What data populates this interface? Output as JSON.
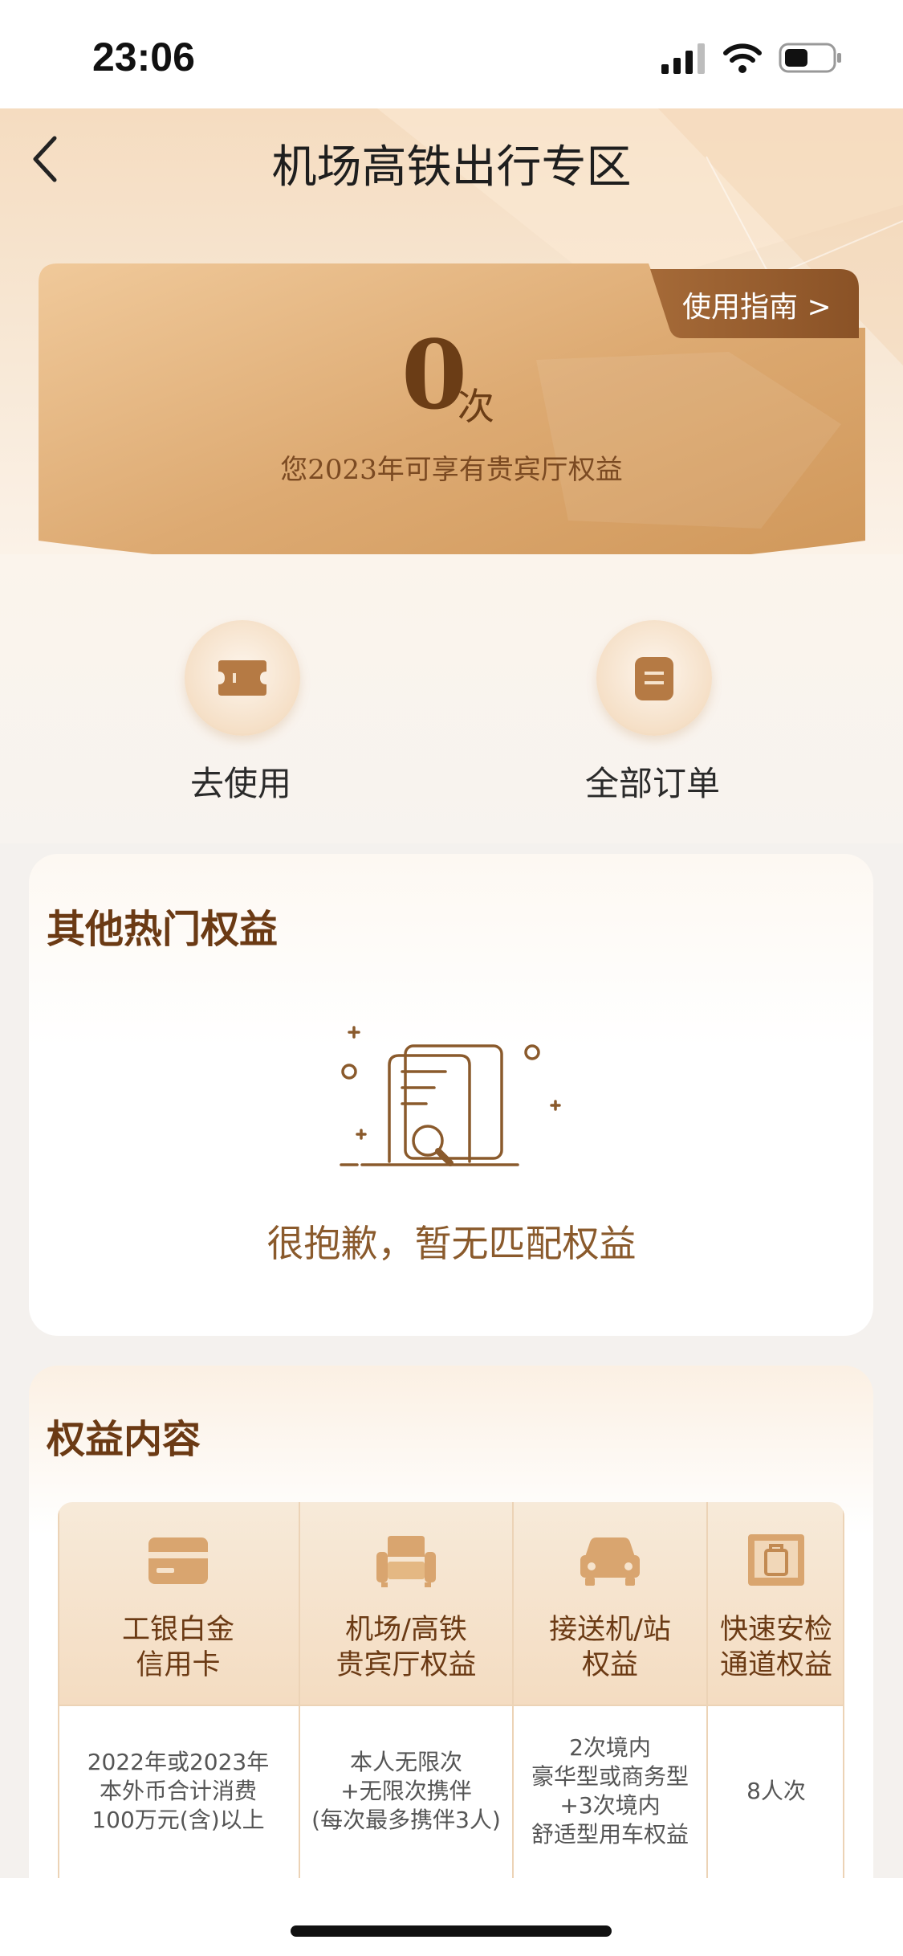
{
  "status_bar": {
    "time": "23:06"
  },
  "header": {
    "title": "机场高铁出行专区"
  },
  "summary": {
    "count": "0",
    "unit": "次",
    "description": "您2023年可享有贵宾厅权益",
    "guide_label": "使用指南 >"
  },
  "actions": [
    {
      "label": "去使用",
      "icon": "ticket-icon"
    },
    {
      "label": "全部订单",
      "icon": "order-list-icon"
    }
  ],
  "hot_rights": {
    "title": "其他热门权益",
    "empty_text": "很抱歉，暂无匹配权益",
    "empty_icon": "document-search-icon"
  },
  "rights": {
    "title": "权益内容",
    "columns": [
      {
        "icon": "credit-card-icon",
        "line1": "工银白金",
        "line2": "信用卡",
        "cell": [
          "2022年或2023年",
          "本外币合计消费",
          "100万元(含)以上"
        ]
      },
      {
        "icon": "armchair-icon",
        "line1": "机场/高铁",
        "line2": "贵宾厅权益",
        "cell": [
          "本人无限次",
          "+无限次携伴",
          "(每次最多携伴3人)"
        ]
      },
      {
        "icon": "car-icon",
        "line1": "接送机/站",
        "line2": "权益",
        "cell": [
          "2次境内",
          "豪华型或商务型",
          "+3次境内",
          "舒适型用车权益"
        ]
      },
      {
        "icon": "luggage-scanner-icon",
        "line1": "快速安检",
        "line2": "通道权益",
        "cell": [
          "8人次"
        ]
      }
    ]
  },
  "colors": {
    "brand_brown": "#6b3a14",
    "gold": "#c98e52",
    "accent_text": "#8a5a2c"
  }
}
